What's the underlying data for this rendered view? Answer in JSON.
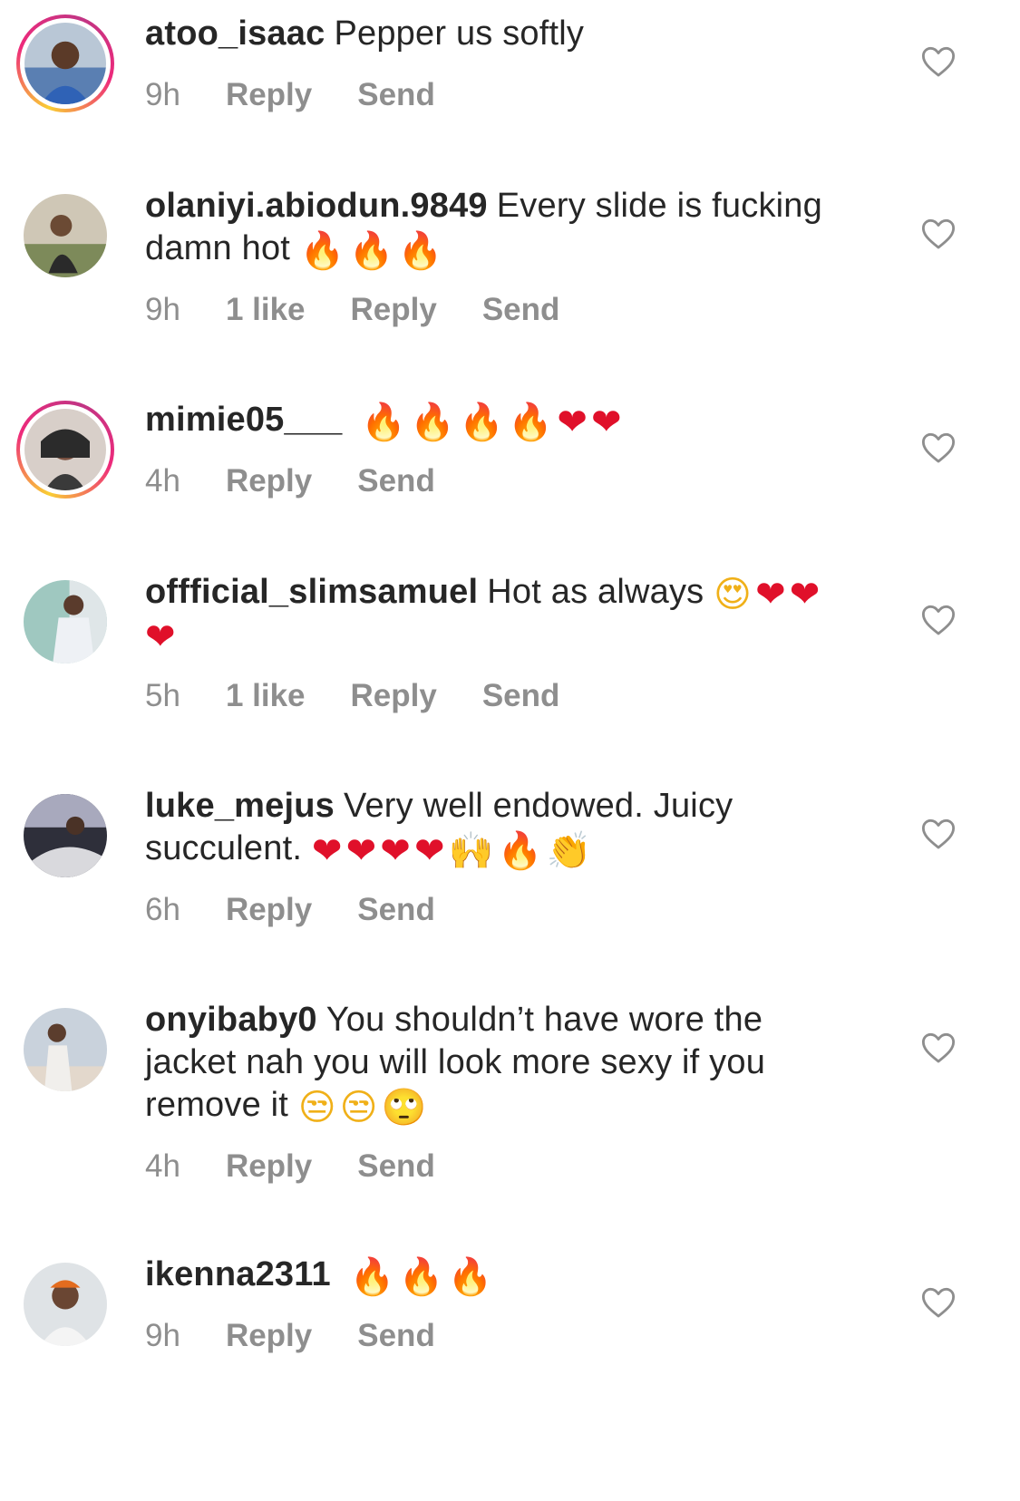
{
  "comments": [
    {
      "username": "atoo_isaac",
      "text": "Pepper us softly",
      "emojis": [],
      "time": "9h",
      "likes": "",
      "reply_label": "Reply",
      "send_label": "Send",
      "story_ring": true
    },
    {
      "username": "olaniyi.abiodun.9849",
      "text": "Every slide is fucking damn hot",
      "emojis": [
        "🔥",
        "🔥",
        "🔥"
      ],
      "time": "9h",
      "likes": "1 like",
      "reply_label": "Reply",
      "send_label": "Send",
      "story_ring": false
    },
    {
      "username": "mimie05___",
      "text": "",
      "emojis": [
        "🔥",
        "🔥",
        "🔥",
        "🔥",
        "❤",
        "❤"
      ],
      "time": "4h",
      "likes": "",
      "reply_label": "Reply",
      "send_label": "Send",
      "story_ring": true
    },
    {
      "username": "offficial_slimsamuel",
      "text": "Hot as always",
      "emojis": [
        "😍",
        "❤",
        "❤",
        "❤"
      ],
      "time": "5h",
      "likes": "1 like",
      "reply_label": "Reply",
      "send_label": "Send",
      "story_ring": false
    },
    {
      "username": "luke_mejus",
      "text": "Very well endowed. Juicy succulent.",
      "emojis": [
        "❤",
        "❤",
        "❤",
        "❤",
        "🙌",
        "🔥",
        "👏"
      ],
      "time": "6h",
      "likes": "",
      "reply_label": "Reply",
      "send_label": "Send",
      "story_ring": false
    },
    {
      "username": "onyibaby0",
      "text": "You shouldn’t have wore the jacket nah you will look more sexy if you remove it",
      "emojis": [
        "😒",
        "😒",
        "🙄"
      ],
      "time": "4h",
      "likes": "",
      "reply_label": "Reply",
      "send_label": "Send",
      "story_ring": false
    },
    {
      "username": "ikenna2311",
      "text": "",
      "emojis": [
        "🔥",
        "🔥",
        "🔥"
      ],
      "time": "9h",
      "likes": "",
      "reply_label": "Reply",
      "send_label": "Send",
      "story_ring": false
    }
  ],
  "icons": {
    "like": "heart-outline-icon"
  },
  "colors": {
    "text": "#262626",
    "meta": "#8e8e8e",
    "heart_emoji": "#e0102a",
    "story_ring_start": "#f9ce34",
    "story_ring_end": "#ee2a7b"
  }
}
